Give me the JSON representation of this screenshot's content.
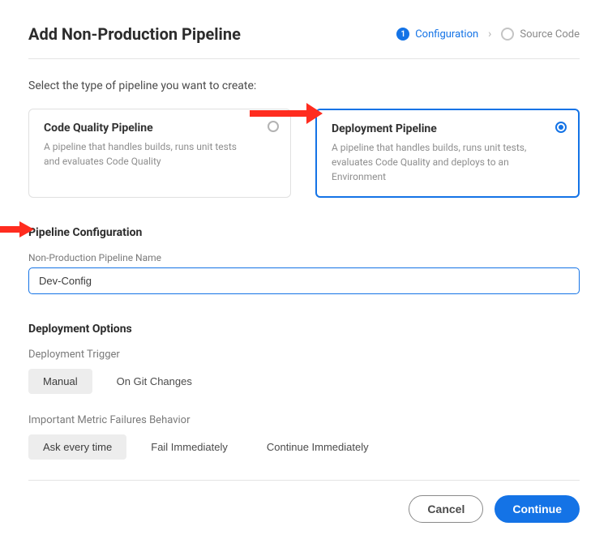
{
  "header": {
    "title": "Add Non-Production Pipeline"
  },
  "stepper": {
    "step1_num": "1",
    "step1_label": "Configuration",
    "step2_label": "Source Code"
  },
  "intro": "Select the type of pipeline you want to create:",
  "cards": {
    "code_quality": {
      "title": "Code Quality Pipeline",
      "desc": "A pipeline that handles builds, runs unit tests and evaluates Code Quality"
    },
    "deployment": {
      "title": "Deployment Pipeline",
      "desc": "A pipeline that handles builds, runs unit tests, evaluates Code Quality and deploys to an Environment"
    }
  },
  "config": {
    "heading": "Pipeline Configuration",
    "name_label": "Non-Production Pipeline Name",
    "name_value": "Dev-Config"
  },
  "deploy_opts": {
    "heading": "Deployment Options",
    "trigger_label": "Deployment Trigger",
    "trigger_options": {
      "manual": "Manual",
      "git": "On Git Changes"
    },
    "metric_label": "Important Metric Failures Behavior",
    "metric_options": {
      "ask": "Ask every time",
      "fail": "Fail Immediately",
      "continue": "Continue Immediately"
    }
  },
  "footer": {
    "cancel": "Cancel",
    "continue": "Continue"
  }
}
